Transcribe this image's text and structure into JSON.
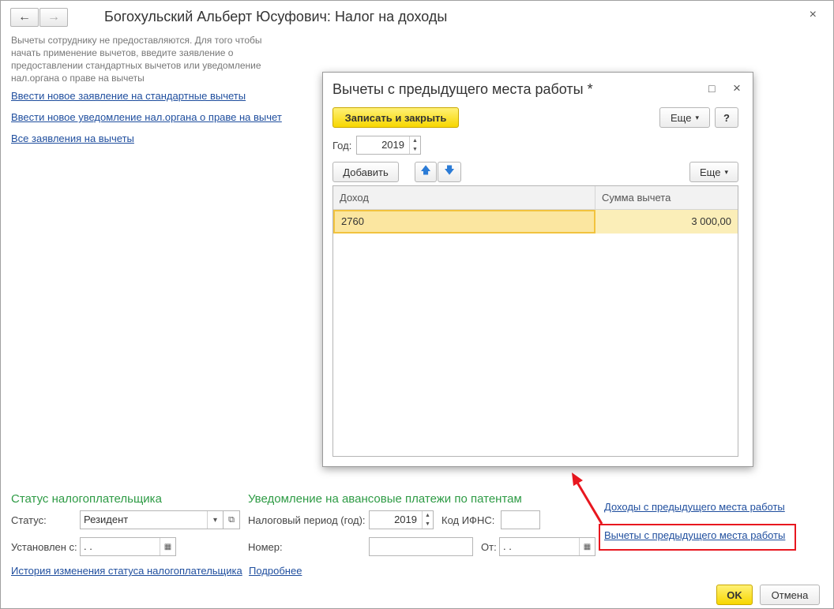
{
  "window": {
    "title": "Богохульский Альберт Юсуфович: Налог на доходы",
    "back_icon": "←",
    "forward_icon": "→",
    "close_icon": "×"
  },
  "info": {
    "text": "Вычеты сотруднику не предоставляются. Для того чтобы начать применение вычетов, введите заявление о предоставлении стандартных вычетов или уведомление нал.органа о праве на вычеты"
  },
  "links": {
    "new_statement": "Ввести новое заявление на стандартные вычеты",
    "new_notification": "Ввести новое уведомление нал.органа о праве на вычет",
    "all_statements": "Все заявления на вычеты",
    "status_history": "История изменения статуса налогоплательщика",
    "details": "Подробнее",
    "income_prev_job": "Доходы с предыдущего места работы",
    "deductions_prev_job": "Вычеты с предыдущего места работы"
  },
  "taxpayer_status": {
    "section_title": "Статус налогоплательщика",
    "status_label": "Статус:",
    "status_value": "Резидент",
    "set_from_label": "Установлен с:",
    "set_from_value": " .  . "
  },
  "patent": {
    "section_title": "Уведомление на авансовые платежи по патентам",
    "period_label": "Налоговый период (год):",
    "period_value": "2019",
    "ifns_label": "Код ИФНС:",
    "ifns_value": "",
    "number_label": "Номер:",
    "number_value": "",
    "from_label": "От:",
    "from_value": " .  . "
  },
  "footer": {
    "ok_label": "OK",
    "cancel_label": "Отмена"
  },
  "dialog": {
    "title": "Вычеты с предыдущего места работы *",
    "save_close_label": "Записать и закрыть",
    "more_label": "Еще",
    "help_label": "?",
    "year_label": "Год:",
    "year_value": "2019",
    "add_label": "Добавить",
    "more_label_2": "Еще",
    "columns": [
      "Доход",
      "Сумма вычета"
    ],
    "rows": [
      {
        "income": "2760",
        "amount": "3 000,00"
      }
    ],
    "maximize_icon": "□",
    "close_icon": "×"
  },
  "colors": {
    "link": "#1f4e9e",
    "section": "#2e9b45",
    "highlight": "#e8171f",
    "selected_row": "#fbeeb8",
    "button_yellow": "#f7d600"
  }
}
